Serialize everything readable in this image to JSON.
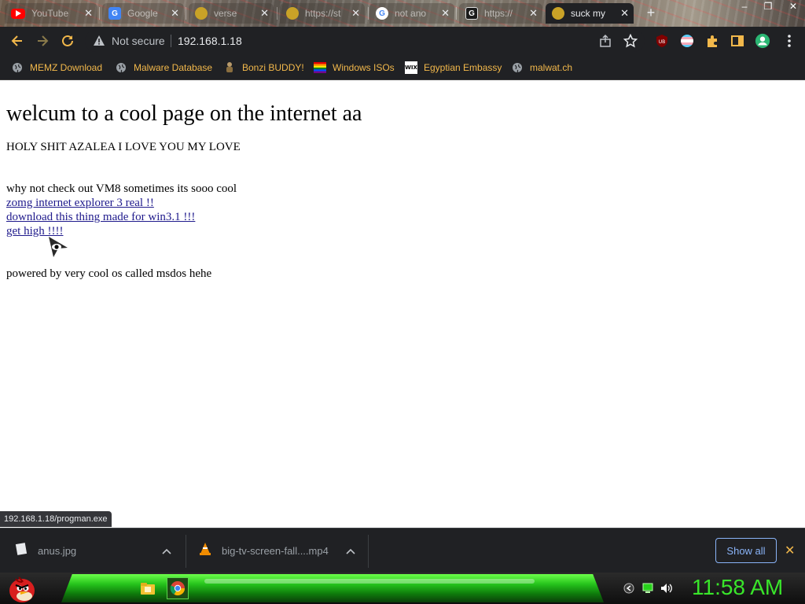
{
  "browser": {
    "tabs": [
      {
        "title": "YouTube",
        "fav": "youtube-icon",
        "active": false
      },
      {
        "title": "Google",
        "fav": "google-docs-icon",
        "active": false
      },
      {
        "title": "verse",
        "fav": "site-icon",
        "active": false
      },
      {
        "title": "https://st",
        "fav": "site-icon",
        "active": false
      },
      {
        "title": "not ano",
        "fav": "google-icon",
        "active": false
      },
      {
        "title": "https://",
        "fav": "g-site-icon",
        "active": false
      },
      {
        "title": "suck my",
        "fav": "site-icon",
        "active": true
      }
    ],
    "new_tab": "+",
    "window_controls": {
      "minimize": "–",
      "maximize": "❐",
      "close": "✕"
    },
    "omnibox": {
      "security_label": "Not secure",
      "url": "192.168.1.18"
    },
    "extension_badge": "UB",
    "bookmarks": [
      {
        "label": "MEMZ Download",
        "icon": "globe-icon"
      },
      {
        "label": "Malware Database",
        "icon": "globe-icon"
      },
      {
        "label": "Bonzi BUDDY!",
        "icon": "bonzi-icon"
      },
      {
        "label": "Windows ISOs",
        "icon": "rainbow-flag-icon"
      },
      {
        "label": "Egyptian Embassy",
        "icon": "wix-icon"
      },
      {
        "label": "malwat.ch",
        "icon": "globe-icon"
      }
    ]
  },
  "page": {
    "heading": "welcum to a cool page on the internet aa",
    "line1": "HOLY SHIT AZALEA I LOVE YOU MY LOVE",
    "line2": "why not check out VM8 sometimes its sooo cool",
    "links": [
      "zomg internet explorer 3 real !!",
      "download this thing made for win3.1 !!!",
      "get high !!!!"
    ],
    "footer": "powered by very cool os called msdos hehe"
  },
  "status_bar": "192.168.1.18/progman.exe",
  "downloads": {
    "items": [
      {
        "name": "anus.jpg"
      },
      {
        "name": "big-tv-screen-fall....mp4"
      }
    ],
    "show_all": "Show all",
    "close": "✕"
  },
  "taskbar": {
    "clock": "11:58 AM"
  },
  "colors": {
    "bookmark_text": "#f2b84b",
    "link": "#1f1a8c",
    "clock": "#39e52a",
    "chrome_bg": "#202124"
  }
}
